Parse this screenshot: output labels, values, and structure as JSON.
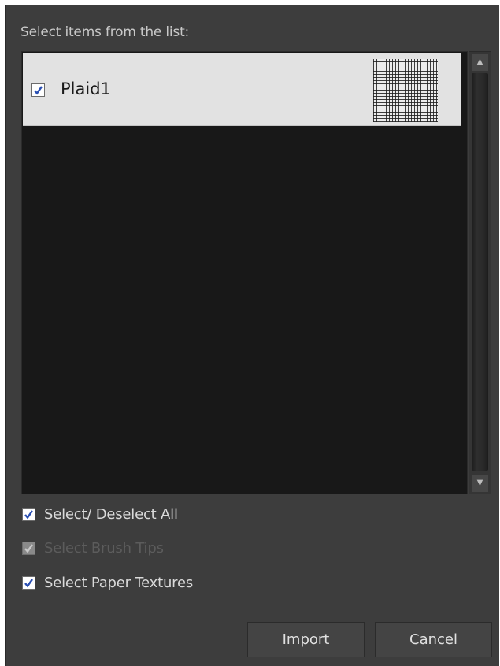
{
  "dialog": {
    "prompt": "Select items from the list:",
    "list": {
      "items": [
        {
          "label": "Plaid1",
          "checked": true,
          "thumbnail": "plaid-texture-thumbnail"
        }
      ]
    },
    "options": [
      {
        "label": "Select/ Deselect All",
        "checked": true,
        "enabled": true
      },
      {
        "label": "Select Brush Tips",
        "checked": true,
        "enabled": false
      },
      {
        "label": "Select Paper Textures",
        "checked": true,
        "enabled": true
      }
    ],
    "buttons": {
      "import": "Import",
      "cancel": "Cancel"
    }
  },
  "icons": {
    "scroll_up": "scroll-up-arrow-icon",
    "scroll_down": "scroll-down-arrow-icon",
    "checkmark": "checkmark-icon"
  },
  "colors": {
    "dialog_bg": "#3d3d3d",
    "list_bg": "#181818",
    "selected_row": "#e2e2e2",
    "check_accent": "#2a4fb3"
  }
}
